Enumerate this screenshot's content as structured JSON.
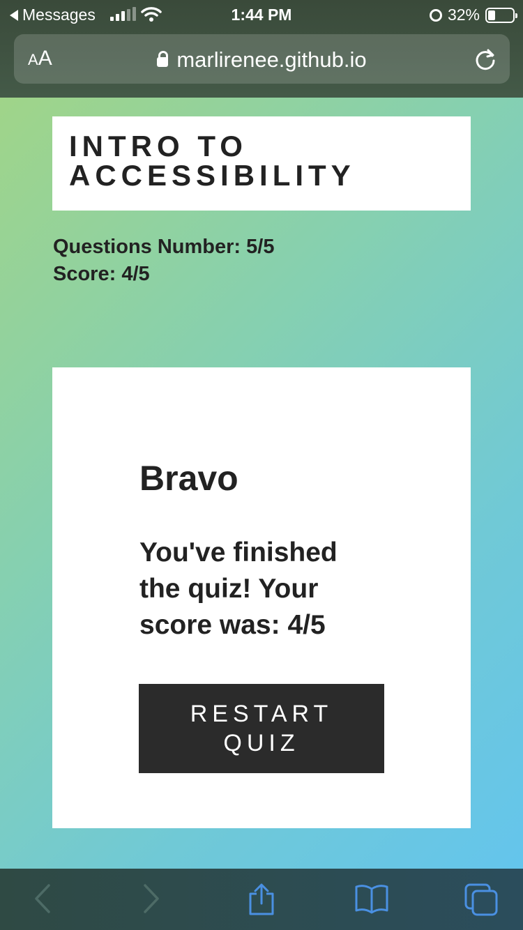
{
  "status_bar": {
    "back_app": "Messages",
    "time": "1:44 PM",
    "battery": "32%",
    "battery_level": 0.32,
    "icons": [
      "cellular-signal-icon",
      "wifi-icon",
      "alarm-icon",
      "battery-icon"
    ]
  },
  "browser": {
    "text_size_small": "A",
    "text_size_large": "A",
    "url": "marlirenee.github.io",
    "icons": [
      "lock-icon",
      "reload-icon"
    ]
  },
  "page": {
    "title": "INTRO TO ACCESSIBILITY",
    "questions_number": "Questions Number: 5/5",
    "score": "Score: 4/5"
  },
  "result": {
    "heading": "Bravo",
    "message": "You've finished the quiz! Your score was: 4/5",
    "restart_label": "RESTART QUIZ"
  },
  "toolbar": {
    "items": [
      "back-icon",
      "forward-icon",
      "share-icon",
      "bookmarks-icon",
      "tabs-icon"
    ]
  },
  "colors": {
    "gradient_start": "#a5d581",
    "gradient_end": "#62c4f0",
    "button_bg": "#2b2b2b",
    "toolbar_icon": "#4a90e2"
  }
}
